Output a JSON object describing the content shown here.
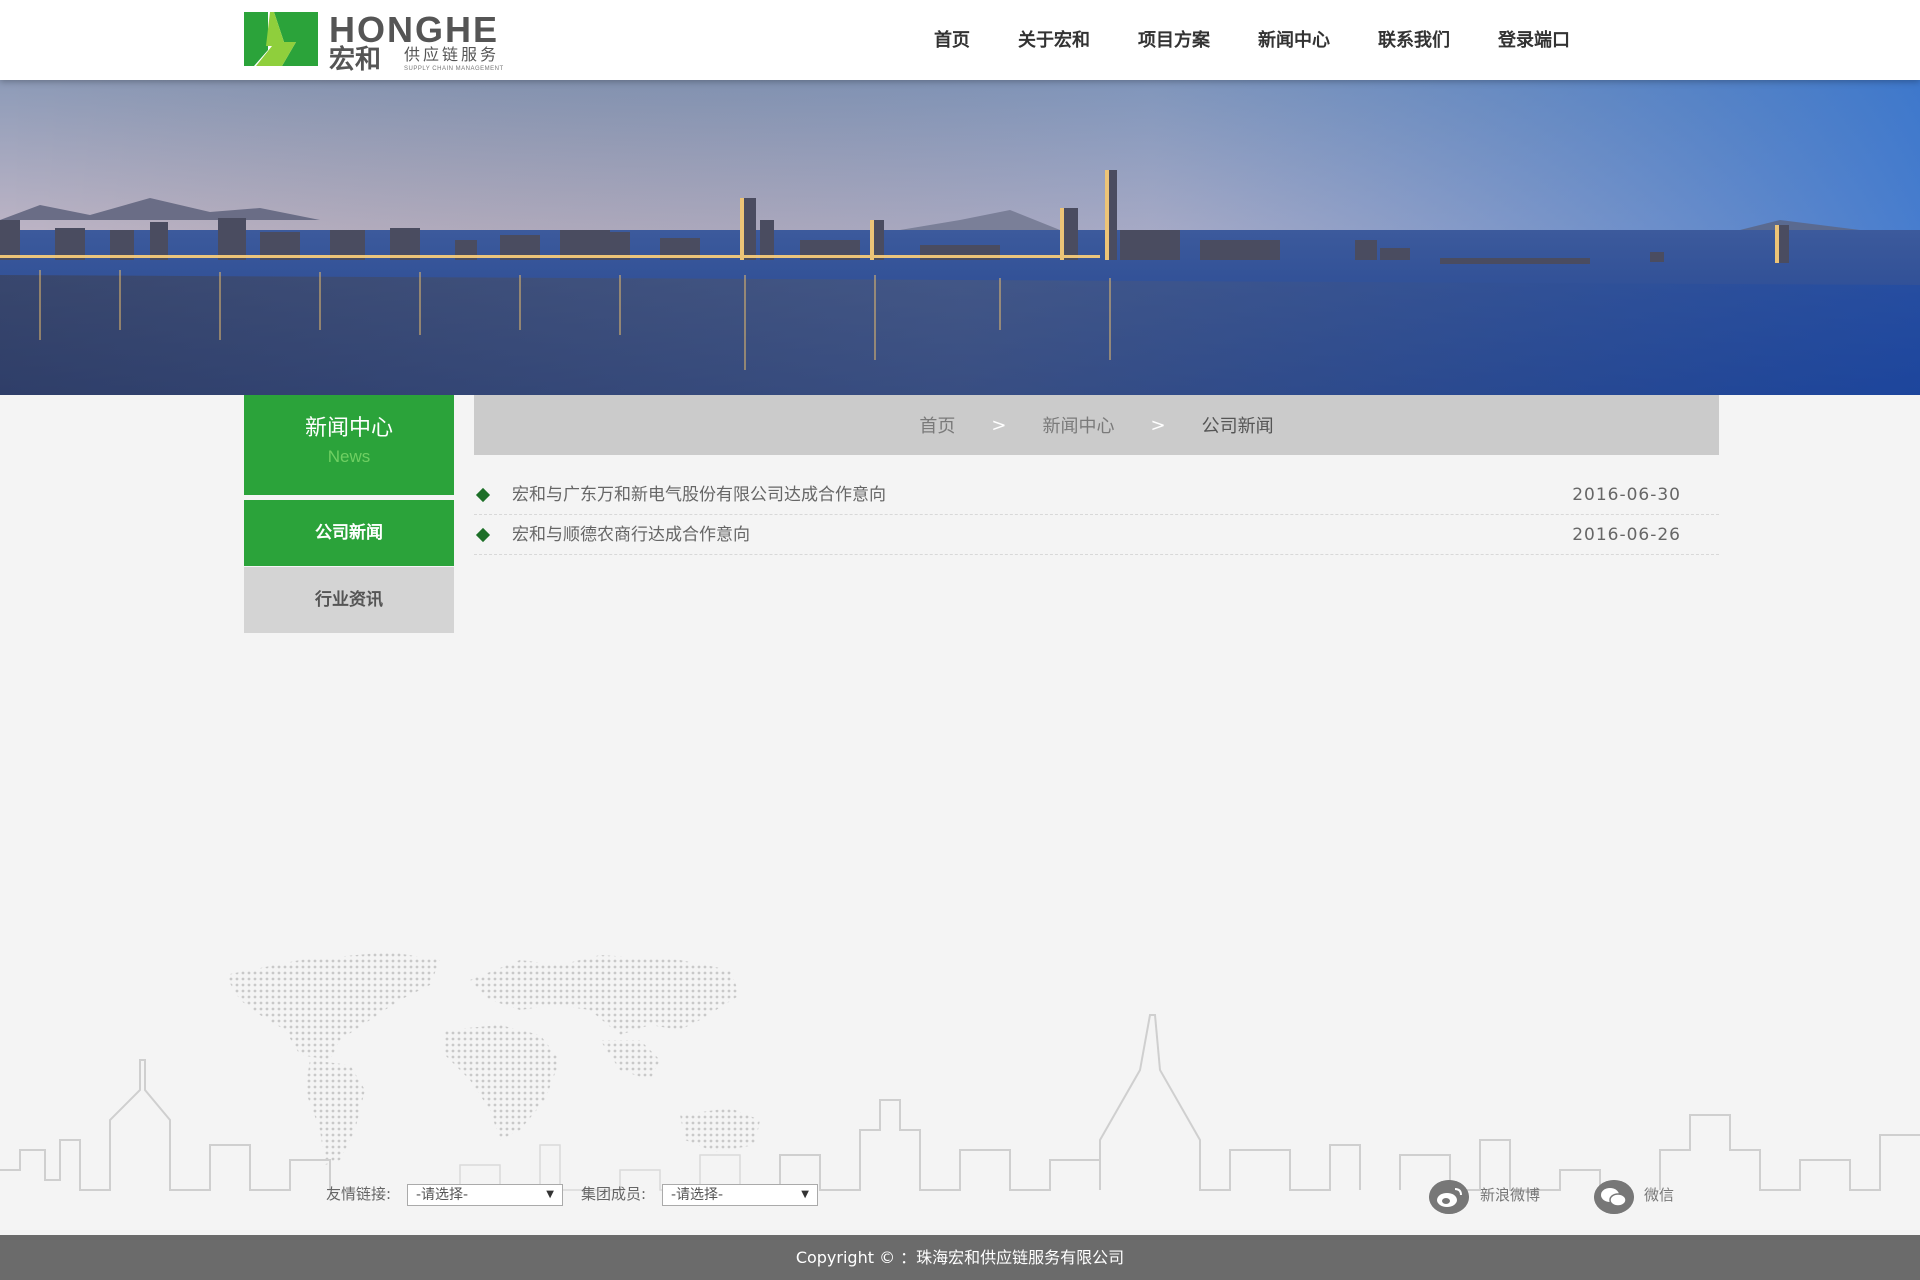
{
  "logo": {
    "en": "HONGHE",
    "cn": "宏和",
    "cn_sub": "供应链服务",
    "tagline": "SUPPLY CHAIN MANAGEMENT"
  },
  "nav": [
    {
      "label": "首页"
    },
    {
      "label": "关于宏和"
    },
    {
      "label": "项目方案"
    },
    {
      "label": "新闻中心"
    },
    {
      "label": "联系我们"
    },
    {
      "label": "登录端口"
    }
  ],
  "colors": {
    "brand_green": "#2ba33a",
    "dark_green": "#1d6f28",
    "footer_gray": "#6b6b6b"
  },
  "sidebar": {
    "title": "新闻中心",
    "subtitle": "News",
    "items": [
      {
        "label": "公司新闻",
        "active": true
      },
      {
        "label": "行业资讯",
        "active": false
      }
    ]
  },
  "breadcrumb": {
    "home": "首页",
    "section": "新闻中心",
    "current": "公司新闻",
    "separator": ">"
  },
  "news": [
    {
      "title": "宏和与广东万和新电气股份有限公司达成合作意向",
      "date": "2016-06-30"
    },
    {
      "title": "宏和与顺德农商行达成合作意向",
      "date": "2016-06-26"
    }
  ],
  "footer": {
    "friend_links_label": "友情链接:",
    "friend_links_value": "-请选择-",
    "group_label": "集团成员:",
    "group_value": "-请选择-",
    "weibo_label": "新浪微博",
    "wechat_label": "微信",
    "weibo_icon": "weibo-icon",
    "wechat_icon": "wechat-icon",
    "copyright": "Copyright © ：珠海宏和供应链服务有限公司"
  }
}
